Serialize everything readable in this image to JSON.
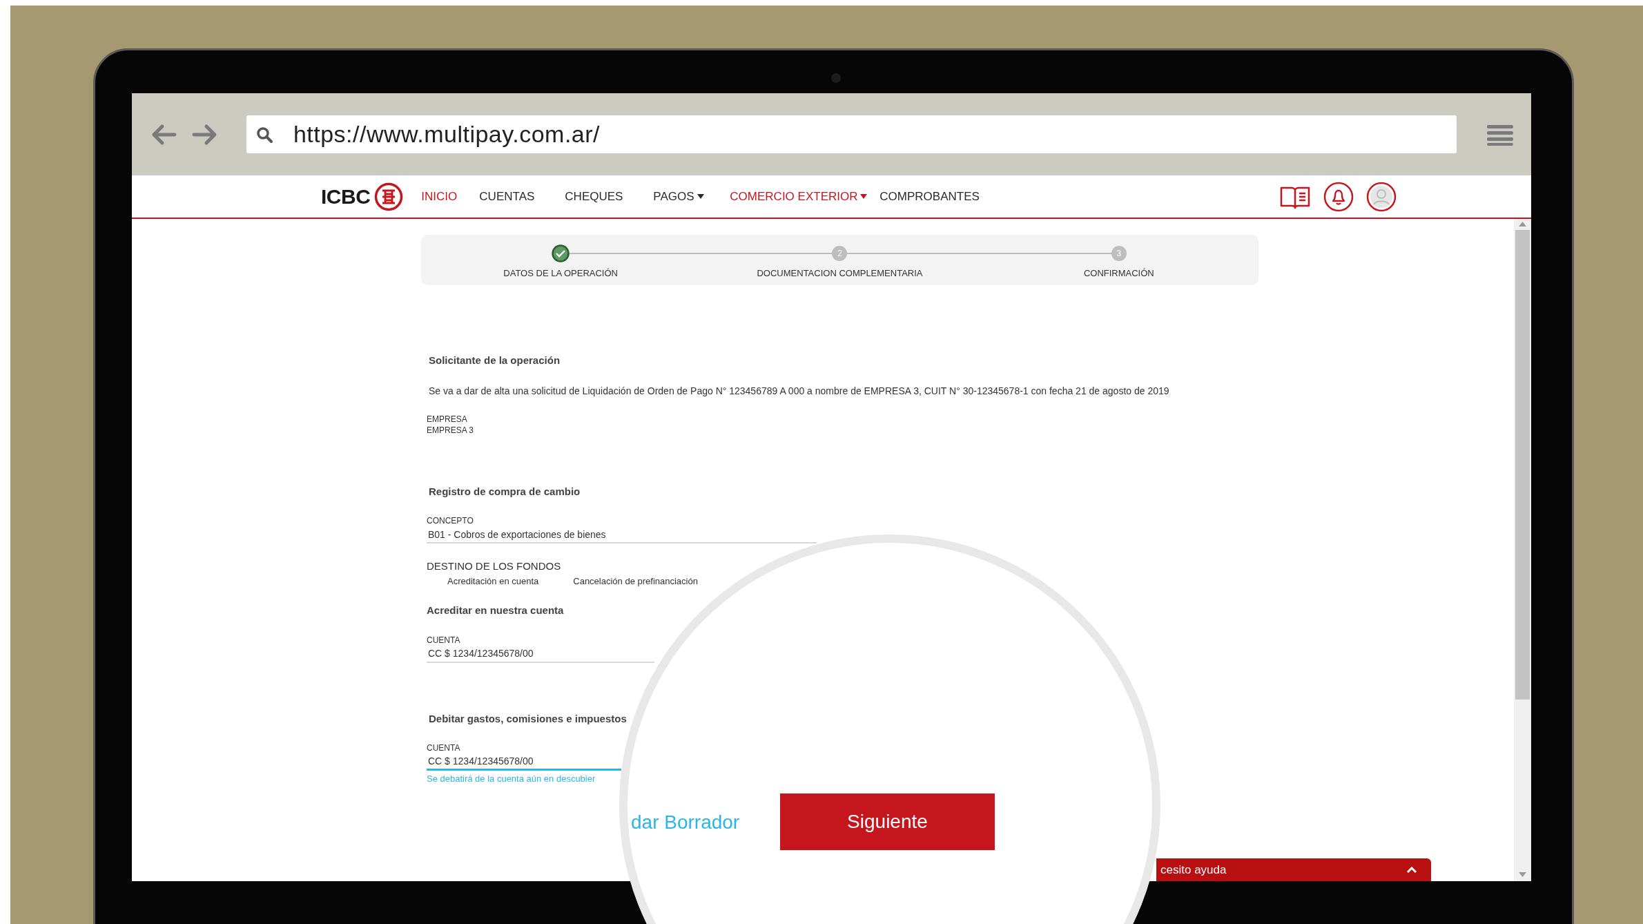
{
  "browser": {
    "url": "https://www.multipay.com.ar/"
  },
  "site": {
    "logo": "ICBC",
    "nav": [
      {
        "label": "INICIO",
        "highlighted": true,
        "dropdown": false
      },
      {
        "label": "CUENTAS",
        "highlighted": false,
        "dropdown": false
      },
      {
        "label": "CHEQUES",
        "highlighted": false,
        "dropdown": false
      },
      {
        "label": "PAGOS",
        "highlighted": false,
        "dropdown": true
      },
      {
        "label": "COMERCIO EXTERIOR",
        "highlighted": true,
        "dropdown": true
      },
      {
        "label": "COMPROBANTES",
        "highlighted": false,
        "dropdown": false
      }
    ]
  },
  "stepper": [
    {
      "label": "DATOS DE LA OPERACIÓN",
      "done": true
    },
    {
      "number": "2",
      "label": "DOCUMENTACION COMPLEMENTARIA",
      "done": false
    },
    {
      "number": "3",
      "label": "CONFIRMACIÓN",
      "done": false
    }
  ],
  "form": [
    {
      "kind": "heading",
      "text": "Solicitante de la operación"
    },
    {
      "kind": "paragraph",
      "text": "Se va a dar de alta una solicitud de Liquidación de Orden de Pago N° 123456789 A 000 a nombre de EMPRESA 3, CUIT N° 30-12345678-1 con fecha 21 de agosto de 2019"
    },
    {
      "kind": "info",
      "label": "EMPRESA",
      "value": "EMPRESA 3"
    },
    {
      "kind": "heading",
      "text": "Registro de compra de cambio"
    },
    {
      "kind": "field",
      "label": "CONCEPTO",
      "value": "B01 - Cobros de exportaciones de bienes",
      "focused": false,
      "wide": true
    },
    {
      "kind": "options",
      "label": "DESTINO DE LOS FONDOS",
      "options": [
        "Acreditación en cuenta",
        "Cancelación de prefinanciación"
      ]
    },
    {
      "kind": "subheading",
      "text": "Acreditar en nuestra cuenta"
    },
    {
      "kind": "field",
      "label": "CUENTA",
      "value": "CC $ 1234/12345678/00",
      "focused": false,
      "wide": false
    },
    {
      "kind": "heading",
      "text": "Debitar gastos, comisiones e impuestos"
    },
    {
      "kind": "field",
      "label": "CUENTA",
      "value": "CC $ 1234/12345678/00",
      "focused": true,
      "wide": false,
      "helper": "Se debatirá de la cuenta aún en descubier"
    }
  ],
  "actions": {
    "draft_link": "dar Borrador",
    "next_button": "Siguiente"
  },
  "help_bar": {
    "text": "cesito ayuda"
  }
}
